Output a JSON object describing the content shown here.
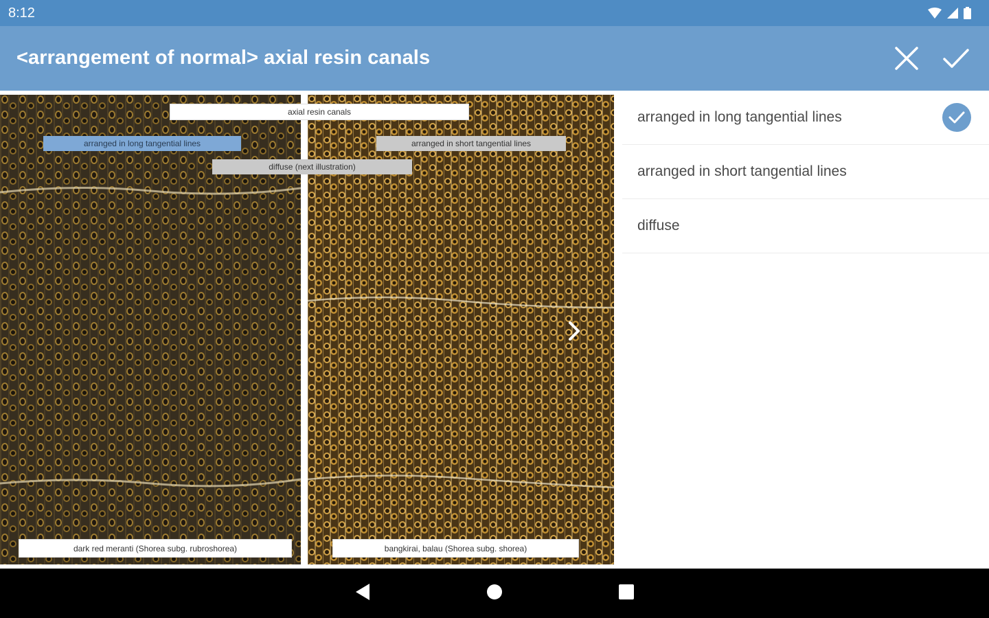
{
  "status_bar": {
    "time": "8:12",
    "icons": [
      "wifi-icon",
      "signal-icon",
      "battery-icon"
    ]
  },
  "app_bar": {
    "title": "<arrangement of normal> axial resin canals",
    "actions": [
      "close-icon",
      "check-icon"
    ]
  },
  "image": {
    "labels": {
      "top": "axial resin canals",
      "long_lines": "arranged in long tangential lines",
      "short_lines": "arranged in short tangential lines",
      "diffuse": "diffuse (next illustration)"
    },
    "captions": {
      "left": "dark red meranti (Shorea subg. rubroshorea)",
      "right": "bangkirai, balau (Shorea subg. shorea)"
    },
    "next_icon": "chevron-right-icon"
  },
  "options": {
    "items": [
      {
        "label": "arranged in long tangential lines",
        "selected": true
      },
      {
        "label": "arranged in short tangential lines",
        "selected": false
      },
      {
        "label": "diffuse",
        "selected": false
      }
    ]
  },
  "nav_bar": {
    "icons": [
      "back-icon",
      "home-icon",
      "recents-icon"
    ]
  },
  "colors": {
    "status_bar": "#4f8cc4",
    "app_bar": "#6d9ecd",
    "accent": "#6d9ecd",
    "nav_bar": "#000000"
  }
}
